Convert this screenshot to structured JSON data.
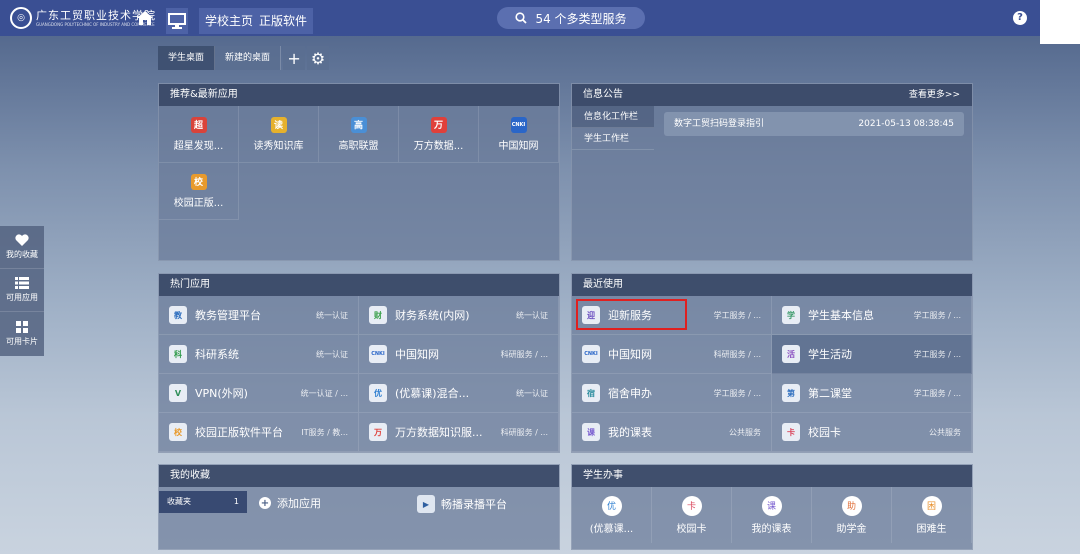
{
  "header": {
    "school_name": "广东工贸职业技术学院",
    "school_name_en": "GUANGDONG POLYTECHNIC OF INDUSTRY AND COMMERCE",
    "tabs": [
      "学校主页",
      "正版软件"
    ],
    "search_label": "54 个多类型服务",
    "help": "?"
  },
  "desktops": {
    "tabs": [
      "学生桌面",
      "新建的桌面"
    ],
    "add": "+",
    "settings": "⚙"
  },
  "recommend": {
    "title": "推荐&最新应用",
    "apps": [
      {
        "label": "超星发现...",
        "icon": "超",
        "color": "#d9433a"
      },
      {
        "label": "读秀知识库",
        "icon": "读",
        "color": "#e6b12c"
      },
      {
        "label": "高职联盟",
        "icon": "高",
        "color": "#4a8fd6"
      },
      {
        "label": "万方数据...",
        "icon": "万",
        "color": "#e0403a"
      },
      {
        "label": "中国知网",
        "icon": "CNKI",
        "color": "#2a66c8"
      },
      {
        "label": "校园正版...",
        "icon": "校",
        "color": "#e89a2c"
      }
    ]
  },
  "notice": {
    "title": "信息公告",
    "more": "查看更多>>",
    "sidebar": [
      "信息化工作栏",
      "学生工作栏"
    ],
    "item": {
      "text": "数字工贸扫码登录指引",
      "date": "2021-05-13 08:38:45"
    }
  },
  "hot": {
    "title": "热门应用",
    "rows": [
      {
        "name": "教务管理平台",
        "tag": "统一认证",
        "icon": "教",
        "color": "#2f6fbf"
      },
      {
        "name": "财务系统(内网)",
        "tag": "统一认证",
        "icon": "财",
        "color": "#3aa04a"
      },
      {
        "name": "科研系统",
        "tag": "统一认证",
        "icon": "科",
        "color": "#2f9a4a"
      },
      {
        "name": "中国知网",
        "tag": "科研服务 / ...",
        "icon": "CNKI",
        "color": "#2a66c8"
      },
      {
        "name": "VPN(外网)",
        "tag": "统一认证 / ...",
        "icon": "V",
        "color": "#2f8f5a"
      },
      {
        "name": "(优慕课)混合...",
        "tag": "统一认证",
        "icon": "优",
        "color": "#2f7fd0"
      },
      {
        "name": "校园正版软件平台",
        "tag": "IT服务 / 教...",
        "icon": "校",
        "color": "#e89a2c"
      },
      {
        "name": "万方数据知识服...",
        "tag": "科研服务 / ...",
        "icon": "万",
        "color": "#e0403a"
      }
    ]
  },
  "recent": {
    "title": "最近使用",
    "rows": [
      {
        "name": "迎新服务",
        "tag": "学工服务 / ...",
        "icon": "迎",
        "color": "#6b4fc0"
      },
      {
        "name": "学生基本信息",
        "tag": "学工服务 / ...",
        "icon": "学",
        "color": "#3a9a6a"
      },
      {
        "name": "中国知网",
        "tag": "科研服务 / ...",
        "icon": "CNKI",
        "color": "#2a66c8"
      },
      {
        "name": "学生活动",
        "tag": "学工服务 / ...",
        "icon": "活",
        "color": "#8a4fc0"
      },
      {
        "name": "宿舍申办",
        "tag": "学工服务 / ...",
        "icon": "宿",
        "color": "#2f8fa0"
      },
      {
        "name": "第二课堂",
        "tag": "学工服务 / ...",
        "icon": "第",
        "color": "#2f6fbf"
      },
      {
        "name": "我的课表",
        "tag": "公共服务",
        "icon": "课",
        "color": "#7a5fd0"
      },
      {
        "name": "校园卡",
        "tag": "公共服务",
        "icon": "卡",
        "color": "#d9435a"
      }
    ]
  },
  "favorites": {
    "title": "我的收藏",
    "folder": "收藏夹",
    "count": "1",
    "add_label": "添加应用",
    "app": "畅播录播平台"
  },
  "services": {
    "title": "学生办事",
    "items": [
      {
        "label": "(优慕课...",
        "icon": "优",
        "color": "#2f7fd0"
      },
      {
        "label": "校园卡",
        "icon": "卡",
        "color": "#d9435a"
      },
      {
        "label": "我的课表",
        "icon": "课",
        "color": "#7a5fd0"
      },
      {
        "label": "助学金",
        "icon": "助",
        "color": "#e0703a"
      },
      {
        "label": "困难生",
        "icon": "困",
        "color": "#e8902c"
      }
    ]
  },
  "leftbar": [
    "我的收藏",
    "可用应用",
    "可用卡片"
  ]
}
